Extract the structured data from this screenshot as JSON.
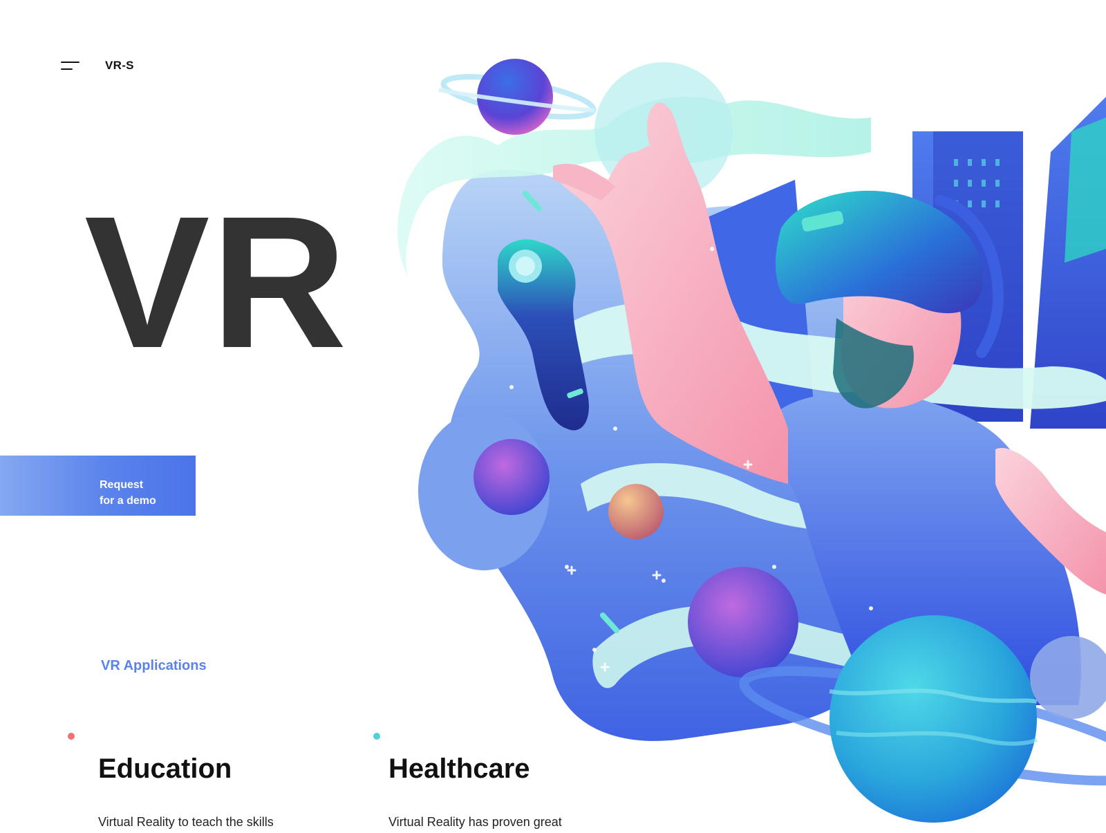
{
  "header": {
    "menu_icon": "hamburger-menu-icon",
    "logo": "VR-S"
  },
  "hero": {
    "title": "VR",
    "cta_line1": "Request",
    "cta_line2": "for a demo"
  },
  "applications": {
    "label": "VR Applications",
    "items": [
      {
        "title": "Education",
        "text": "Virtual Reality to teach the skills",
        "dot_color": "#f07078"
      },
      {
        "title": "Healthcare",
        "text": "Virtual Reality has proven great",
        "dot_color": "#4fd2d6"
      }
    ]
  },
  "colors": {
    "accent": "#5b82e9",
    "hero_text": "#333333"
  },
  "illustration": {
    "icon": "vr-headset-person-illustration"
  }
}
